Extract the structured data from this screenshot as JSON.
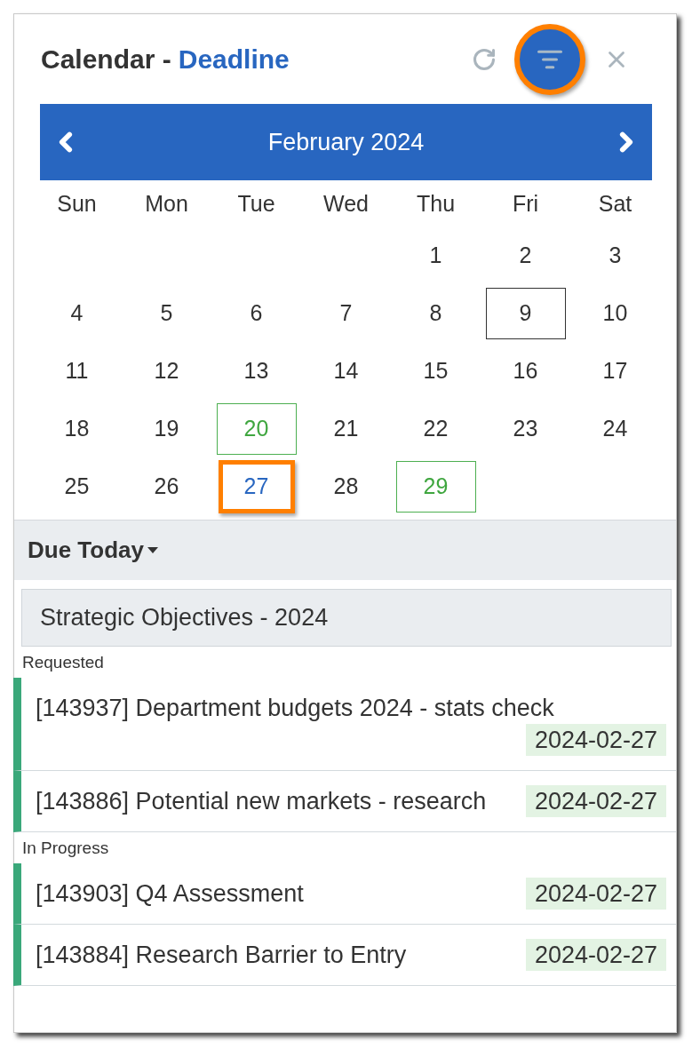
{
  "header": {
    "title": "Calendar -",
    "context": "Deadline",
    "actions": [
      {
        "kind": "refresh",
        "active": false,
        "highlighted": false
      },
      {
        "kind": "filter",
        "active": true,
        "highlighted": true
      },
      {
        "kind": "close",
        "active": false,
        "highlighted": false
      }
    ]
  },
  "month_nav": {
    "label": "February 2024"
  },
  "weekdays": [
    "Sun",
    "Mon",
    "Tue",
    "Wed",
    "Thu",
    "Fri",
    "Sat"
  ],
  "weeks": [
    {
      "kind": "first",
      "days": [
        {
          "label": "1",
          "kind": "plain",
          "selected": false,
          "highlighted": false
        },
        {
          "label": "2",
          "kind": "plain",
          "selected": false,
          "highlighted": false
        },
        {
          "label": "3",
          "kind": "plain",
          "selected": false,
          "highlighted": false
        }
      ]
    },
    {
      "kind": "full",
      "days": [
        {
          "label": "4",
          "kind": "plain",
          "selected": false,
          "highlighted": false
        },
        {
          "label": "5",
          "kind": "plain",
          "selected": false,
          "highlighted": false
        },
        {
          "label": "6",
          "kind": "plain",
          "selected": false,
          "highlighted": false
        },
        {
          "label": "7",
          "kind": "plain",
          "selected": false,
          "highlighted": false
        },
        {
          "label": "8",
          "kind": "plain",
          "selected": false,
          "highlighted": false
        },
        {
          "label": "9",
          "kind": "today",
          "selected": false,
          "highlighted": false
        },
        {
          "label": "10",
          "kind": "plain",
          "selected": false,
          "highlighted": false
        }
      ]
    },
    {
      "kind": "full",
      "days": [
        {
          "label": "11",
          "kind": "plain",
          "selected": false,
          "highlighted": false
        },
        {
          "label": "12",
          "kind": "plain",
          "selected": false,
          "highlighted": false
        },
        {
          "label": "13",
          "kind": "plain",
          "selected": false,
          "highlighted": false
        },
        {
          "label": "14",
          "kind": "plain",
          "selected": false,
          "highlighted": false
        },
        {
          "label": "15",
          "kind": "plain",
          "selected": false,
          "highlighted": false
        },
        {
          "label": "16",
          "kind": "plain",
          "selected": false,
          "highlighted": false
        },
        {
          "label": "17",
          "kind": "plain",
          "selected": false,
          "highlighted": false
        }
      ]
    },
    {
      "kind": "full",
      "days": [
        {
          "label": "18",
          "kind": "plain",
          "selected": false,
          "highlighted": false
        },
        {
          "label": "19",
          "kind": "plain",
          "selected": false,
          "highlighted": false
        },
        {
          "label": "20",
          "kind": "deadline",
          "selected": false,
          "highlighted": false
        },
        {
          "label": "21",
          "kind": "plain",
          "selected": false,
          "highlighted": false
        },
        {
          "label": "22",
          "kind": "plain",
          "selected": false,
          "highlighted": false
        },
        {
          "label": "23",
          "kind": "plain",
          "selected": false,
          "highlighted": false
        },
        {
          "label": "24",
          "kind": "plain",
          "selected": false,
          "highlighted": false
        }
      ]
    },
    {
      "kind": "last",
      "days": [
        {
          "label": "25",
          "kind": "plain",
          "selected": false,
          "highlighted": false
        },
        {
          "label": "26",
          "kind": "plain",
          "selected": false,
          "highlighted": false
        },
        {
          "label": "27",
          "kind": "plain",
          "selected": true,
          "highlighted": true
        },
        {
          "label": "28",
          "kind": "plain",
          "selected": false,
          "highlighted": false
        },
        {
          "label": "29",
          "kind": "deadline",
          "selected": false,
          "highlighted": false
        }
      ]
    }
  ],
  "due_section": {
    "label": "Due Today"
  },
  "group": {
    "title": "Strategic Objectives - 2024",
    "statuses": [
      {
        "label": "Requested",
        "items": [
          {
            "title": "[143937] Department budgets 2024 - stats check",
            "date": "2024-02-27"
          },
          {
            "title": "[143886] Potential new markets - research",
            "date": "2024-02-27"
          }
        ]
      },
      {
        "label": "In Progress",
        "items": [
          {
            "title": "[143903] Q4 Assessment",
            "date": "2024-02-27"
          },
          {
            "title": "[143884] Research Barrier to Entry",
            "date": "2024-02-27"
          }
        ]
      }
    ]
  }
}
